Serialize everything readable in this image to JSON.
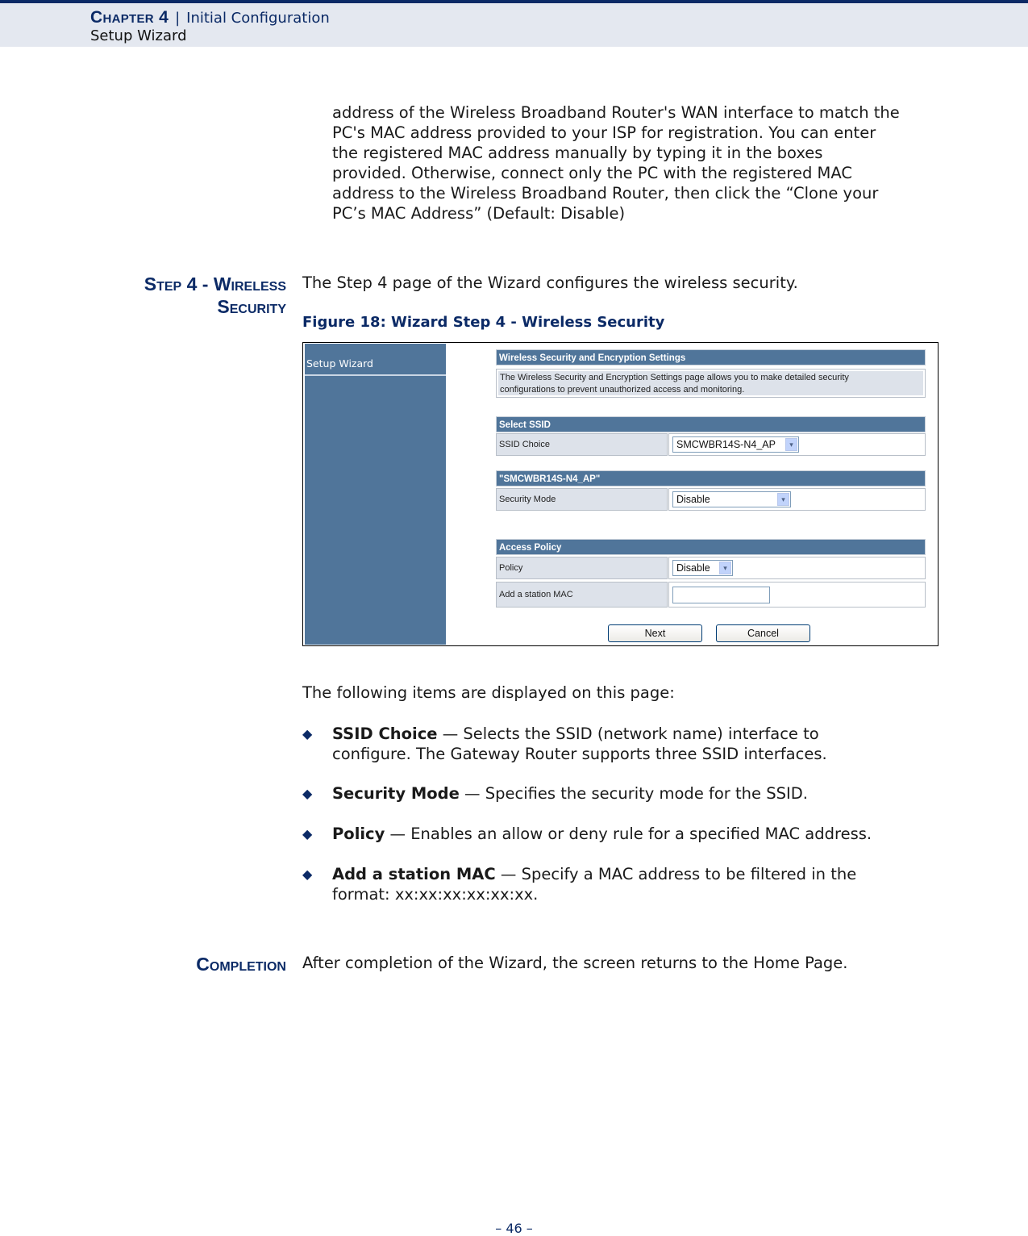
{
  "header": {
    "chapter": "Chapter 4",
    "separator": "|",
    "chapter_title": "Initial Configuration",
    "section": "Setup Wizard"
  },
  "intro_lines": [
    "address of the Wireless Broadband Router's WAN interface to match the",
    "PC's MAC address provided to your ISP for registration. You can enter",
    "the registered MAC address manually by typing it in the boxes",
    "provided. Otherwise, connect only the PC with the registered MAC",
    "address to the Wireless Broadband Router, then click the “Clone your",
    "PC’s MAC Address” (Default: Disable)"
  ],
  "step4": {
    "heading_line1": "Step 4 - Wireless",
    "heading_line2": "Security",
    "description": "The Step 4 page of the Wizard configures the wireless security.",
    "figure_caption": "Figure 18:  Wizard Step 4 - Wireless Security"
  },
  "figure": {
    "sidebar_title": "Setup Wizard",
    "main_section_title": "Wireless Security and Encryption Settings",
    "info_line1": "The Wireless Security and Encryption Settings page allows you to make detailed security",
    "info_line2": "configurations to prevent unauthorized access and monitoring.",
    "select_ssid_title": "Select SSID",
    "ssid_choice_label": "SSID Choice",
    "ssid_choice_value": "SMCWBR14S-N4_AP",
    "ssid_section_title": "\"SMCWBR14S-N4_AP\"",
    "security_mode_label": "Security Mode",
    "security_mode_value": "Disable",
    "access_policy_title": "Access Policy",
    "policy_label": "Policy",
    "policy_value": "Disable",
    "station_mac_label": "Add a station MAC",
    "station_mac_value": "",
    "next_label": "Next",
    "cancel_label": "Cancel",
    "dropdown_arrow": "▾"
  },
  "items_intro": "The following items are displayed on this page:",
  "bullet_glyph": "◆",
  "items": [
    {
      "term": "SSID Choice",
      "line1": " — Selects the SSID (network name) interface to",
      "line2": "configure. The Gateway Router supports three SSID interfaces."
    },
    {
      "term": "Security Mode",
      "line1": " — Specifies the security mode for the SSID.",
      "line2": ""
    },
    {
      "term": "Policy",
      "line1": " — Enables an allow or deny rule for a specified MAC address.",
      "line2": ""
    },
    {
      "term": "Add a station MAC",
      "line1": " — Specify a MAC address to be filtered in the",
      "line2": "format: xx:xx:xx:xx:xx:xx."
    }
  ],
  "completion": {
    "heading": "Completion",
    "text": "After completion of the Wizard, the screen returns to the Home Page."
  },
  "page_number": "–  46  –"
}
